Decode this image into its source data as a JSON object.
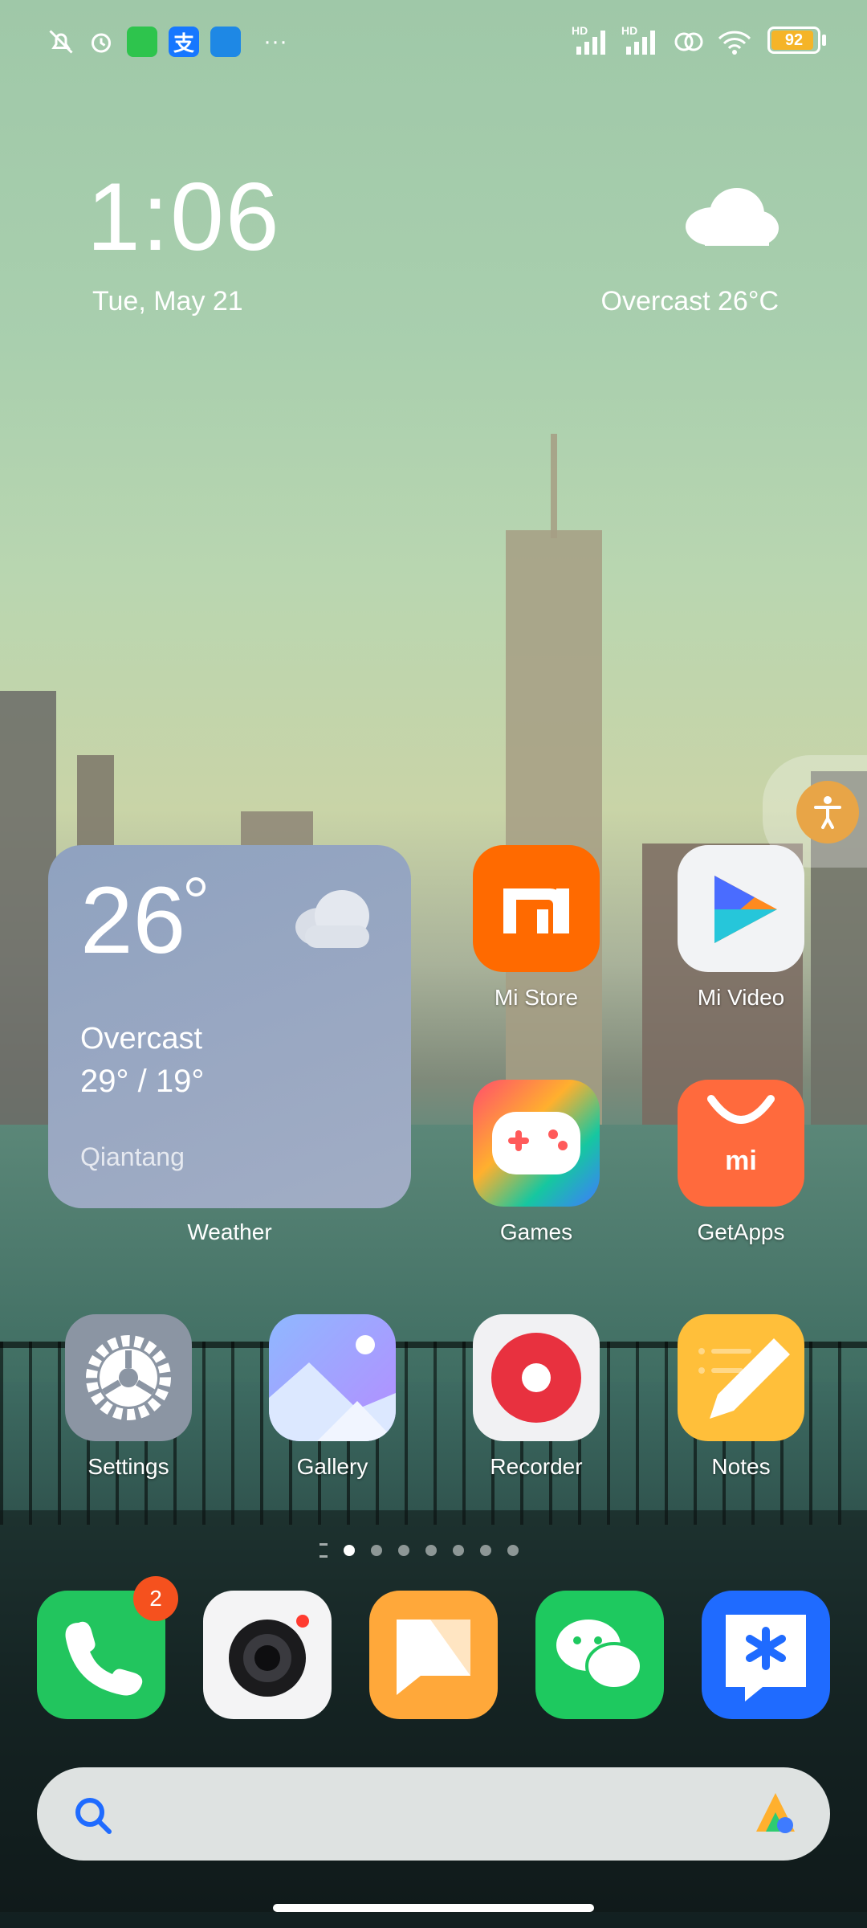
{
  "status_bar": {
    "battery_level": "92",
    "network_1": "HD",
    "network_2": "HD",
    "more_indicator": "···"
  },
  "lock_clock": {
    "time": "1:06",
    "date": "Tue, May 21",
    "weather_summary": "Overcast 26°C"
  },
  "weather_widget": {
    "temperature": "26",
    "condition": "Overcast",
    "range": "29° / 19°",
    "location": "Qiantang",
    "label": "Weather"
  },
  "apps_row1": [
    {
      "label": "Mi Store",
      "icon": "mi-store-icon"
    },
    {
      "label": "Mi Video",
      "icon": "mi-video-icon"
    }
  ],
  "apps_row2": [
    {
      "label": "Games",
      "icon": "games-icon"
    },
    {
      "label": "GetApps",
      "icon": "getapps-icon"
    }
  ],
  "apps_row3": [
    {
      "label": "Settings",
      "icon": "settings-icon"
    },
    {
      "label": "Gallery",
      "icon": "gallery-icon"
    },
    {
      "label": "Recorder",
      "icon": "recorder-icon"
    },
    {
      "label": "Notes",
      "icon": "notes-icon"
    }
  ],
  "dock": [
    {
      "icon": "phone-icon",
      "badge": "2"
    },
    {
      "icon": "camera-icon"
    },
    {
      "icon": "messages-icon"
    },
    {
      "icon": "wechat-icon"
    },
    {
      "icon": "dingtalk-icon"
    }
  ],
  "page_indicator": {
    "pages": 8,
    "active": 1
  },
  "colors": {
    "mi_store": "#ff6a00",
    "getapps": "#ff6a3d",
    "phone": "#22c55e",
    "wechat": "#1ec95f",
    "dingtalk": "#1f6bff",
    "notes": "#ffb62e",
    "recorder": "#e8313f"
  }
}
